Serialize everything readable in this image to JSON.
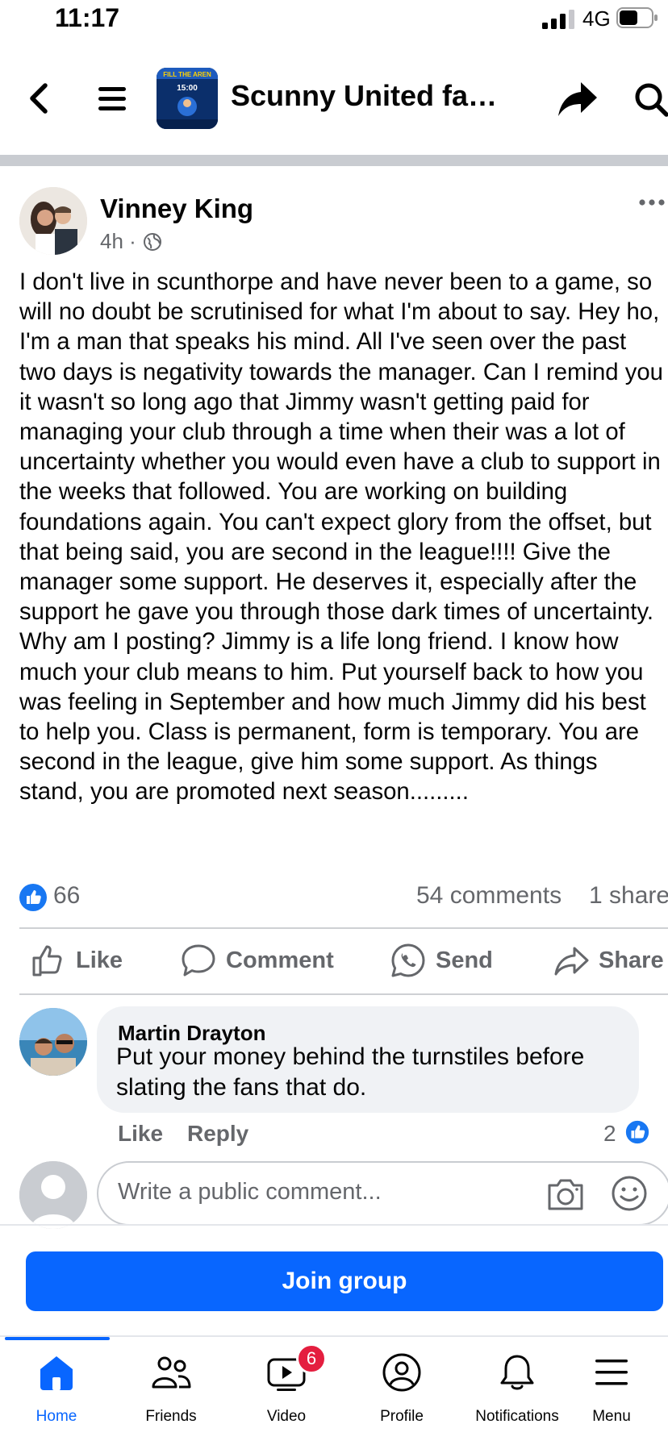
{
  "status_bar": {
    "time": "11:17",
    "network": "4G"
  },
  "header": {
    "group_name": "Scunny United fan...",
    "thumb_text": "FILL THE AREN\n01 Mar 2024\n15:00"
  },
  "post": {
    "author": "Vinney King",
    "time": "4h ·",
    "text": "I don't live in scunthorpe and have never been to a game, so will no doubt be scrutinised for what I'm about to say. Hey ho, I'm a man that speaks his mind. All I've seen over the past two days is negativity towards the manager. Can I remind you it wasn't so long ago that Jimmy wasn't getting paid for managing your club through a time when their was a lot of uncertainty whether you would even have a club to support in the weeks that followed. You are working on building foundations again. You can't expect glory from the offset, but that being said, you are second in the league!!!! Give the manager some support. He deserves it, especially after the support he gave you through those dark times of uncertainty. Why am I posting? Jimmy is a life long friend. I know how much your club means to him. Put yourself back to how you was feeling in September and how much Jimmy did his best to help you. Class is permanent, form is temporary. You are second in the league, give him some support. As things stand, you are promoted next season.........",
    "reactions": "66",
    "comments": "54 comments",
    "shares": "1 share"
  },
  "actions": {
    "like": "Like",
    "comment": "Comment",
    "send": "Send",
    "share": "Share"
  },
  "comment": {
    "author": "Martin Drayton",
    "text": "Put your money behind the turnstiles before slating the fans that do.",
    "like": "Like",
    "reply": "Reply",
    "likes": "2"
  },
  "composer": {
    "placeholder": "Write a public comment..."
  },
  "join_button": "Join group",
  "tabs": [
    {
      "label": "Home",
      "icon": "home-icon",
      "active": true
    },
    {
      "label": "Friends",
      "icon": "friends-icon"
    },
    {
      "label": "Video",
      "icon": "video-icon",
      "badge": "6"
    },
    {
      "label": "Profile",
      "icon": "profile-icon"
    },
    {
      "label": "Notifications",
      "icon": "bell-icon"
    },
    {
      "label": "Menu",
      "icon": "menu-icon"
    }
  ],
  "colors": {
    "accent": "#0866ff",
    "badge": "#e41e3f",
    "muted": "#65676b"
  }
}
